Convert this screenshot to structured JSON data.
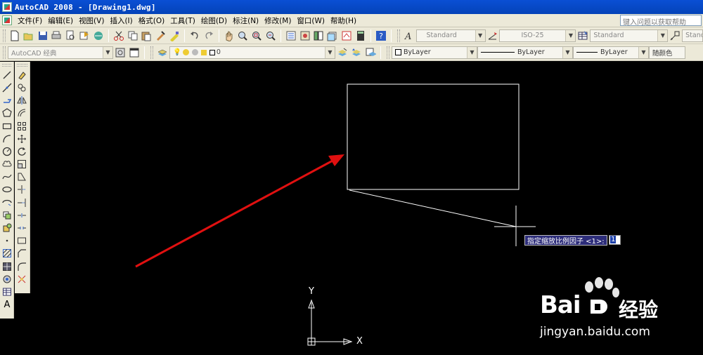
{
  "window": {
    "title": "AutoCAD 2008 - [Drawing1.dwg]"
  },
  "menu": {
    "items": [
      "文件(F)",
      "编辑(E)",
      "视图(V)",
      "插入(I)",
      "格式(O)",
      "工具(T)",
      "绘图(D)",
      "标注(N)",
      "修改(M)",
      "窗口(W)",
      "帮助(H)"
    ],
    "help_search_placeholder": "键入问题以获取帮助"
  },
  "toolbar_styles": {
    "text_style": "Standard",
    "dim_style": "ISO-25",
    "table_style": "Standard",
    "multileader_style": "Standa"
  },
  "toolbar_layers": {
    "workspace": "AutoCAD 经典",
    "current_layer": "0",
    "color": "ByLayer",
    "linetype": "ByLayer",
    "lineweight": "ByLayer",
    "plot_style": "随颜色"
  },
  "command_prompt": {
    "text": "指定缩放比例因子 <1>:",
    "value": "1"
  },
  "ucs": {
    "x_label": "X",
    "y_label": "Y"
  },
  "watermark": {
    "brand": "Bai",
    "suffix": "经验",
    "url": "jingyan.baidu.com"
  },
  "colors": {
    "title_bar": "#0a4fd4",
    "chrome": "#ece9d8",
    "canvas": "#000000",
    "arrow": "#e01010",
    "prompt_bg": "#2d2d7a"
  },
  "icons": {
    "standard_toolbar": [
      "new-icon",
      "open-icon",
      "save-icon",
      "plot-icon",
      "plot-preview-icon",
      "publish-icon",
      "3d-dwf-icon",
      "cut-icon",
      "copy-icon",
      "paste-icon",
      "match-properties-icon",
      "block-editor-icon",
      "undo-icon",
      "redo-icon",
      "pan-icon",
      "zoom-realtime-icon",
      "zoom-window-icon",
      "zoom-previous-icon",
      "properties-icon",
      "design-center-icon",
      "tool-palettes-icon",
      "sheet-set-icon",
      "markup-icon",
      "quickcalc-icon",
      "help-icon"
    ],
    "draw_toolbar": [
      "line-icon",
      "construction-line-icon",
      "polyline-icon",
      "polygon-icon",
      "rectangle-icon",
      "arc-icon",
      "circle-icon",
      "revision-cloud-icon",
      "spline-icon",
      "ellipse-icon",
      "ellipse-arc-icon",
      "insert-block-icon",
      "make-block-icon",
      "point-icon",
      "hatch-icon",
      "gradient-icon",
      "region-icon",
      "table-icon",
      "mtext-icon"
    ],
    "modify_toolbar": [
      "erase-icon",
      "copy-object-icon",
      "mirror-icon",
      "offset-icon",
      "array-icon",
      "move-icon",
      "rotate-icon",
      "scale-icon",
      "stretch-icon",
      "trim-icon",
      "extend-icon",
      "break-at-point-icon",
      "break-icon",
      "join-icon",
      "chamfer-icon",
      "fillet-icon",
      "explode-icon"
    ]
  }
}
